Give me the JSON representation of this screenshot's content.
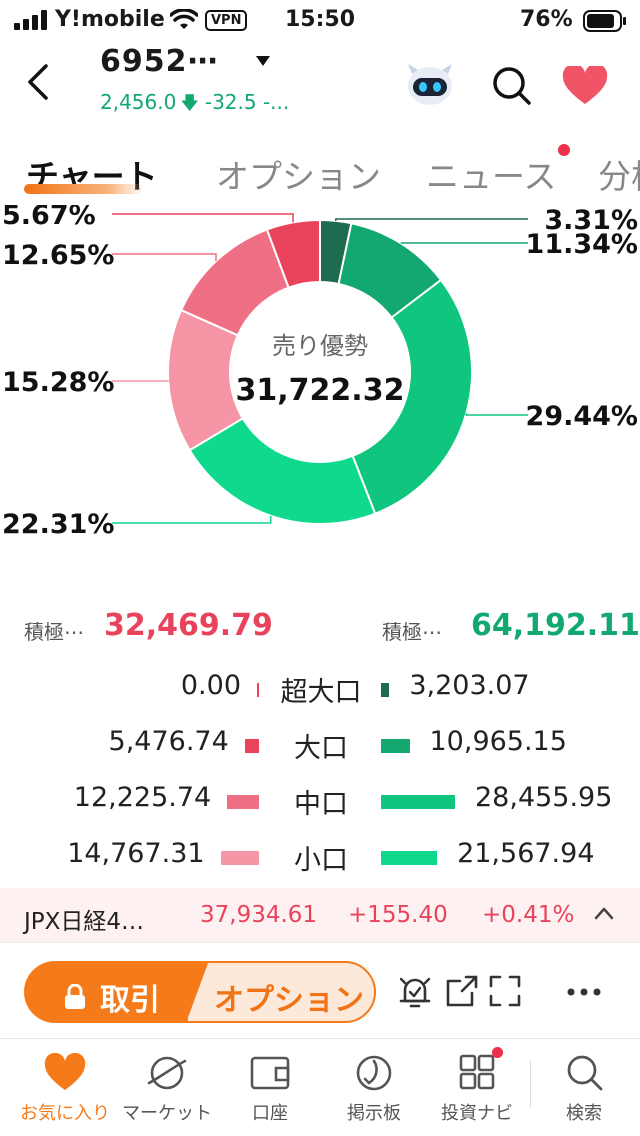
{
  "status_bar": {
    "carrier": "Y!mobile",
    "vpn": "VPN",
    "time": "15:50",
    "battery": "76%"
  },
  "header": {
    "stock_code": "6952⋯",
    "price": "2,456.0",
    "change": "-32.5",
    "change_pct": "-...",
    "quote_color": "#12a870"
  },
  "tabs": [
    {
      "label": "チャート",
      "active": true
    },
    {
      "label": "オプション",
      "active": false
    },
    {
      "label": "ニュース",
      "active": false
    },
    {
      "label": "分析",
      "active": false
    }
  ],
  "donut": {
    "center_label": "売り優勢",
    "center_value": "31,722.32",
    "segments": [
      {
        "pct": 3.31,
        "label": "3.31%",
        "color": "#1f6b4f"
      },
      {
        "pct": 11.34,
        "label": "11.34%",
        "color": "#12a870"
      },
      {
        "pct": 29.44,
        "label": "29.44%",
        "color": "#10c67e"
      },
      {
        "pct": 22.31,
        "label": "22.31%",
        "color": "#0fd98c"
      },
      {
        "pct": 15.28,
        "label": "15.28%",
        "color": "#f595a6"
      },
      {
        "pct": 12.65,
        "label": "12.65%",
        "color": "#ef6f84"
      },
      {
        "pct": 5.67,
        "label": "5.67%",
        "color": "#e9435c"
      }
    ]
  },
  "summary": {
    "sell_label": "積極⋯",
    "sell_value": "32,469.79",
    "buy_label": "積極⋯",
    "buy_value": "64,192.11"
  },
  "breakdown": [
    {
      "label": "超大口",
      "sell": "0.00",
      "sell_num": 0.0,
      "buy": "3,203.07",
      "buy_num": 3203.07,
      "sell_color": "#e9435c",
      "buy_color": "#1f6b4f"
    },
    {
      "label": "大口",
      "sell": "5,476.74",
      "sell_num": 5476.74,
      "buy": "10,965.15",
      "buy_num": 10965.15,
      "sell_color": "#e9435c",
      "buy_color": "#12a870"
    },
    {
      "label": "中口",
      "sell": "12,225.74",
      "sell_num": 12225.74,
      "buy": "28,455.95",
      "buy_num": 28455.95,
      "sell_color": "#ef6f84",
      "buy_color": "#10c67e"
    },
    {
      "label": "小口",
      "sell": "14,767.31",
      "sell_num": 14767.31,
      "buy": "21,567.94",
      "buy_num": 21567.94,
      "sell_color": "#f595a6",
      "buy_color": "#0fd98c"
    }
  ],
  "index_bar": {
    "name": "JPX日経4…",
    "price": "37,934.61",
    "change": "+155.40",
    "pct": "+0.41%"
  },
  "actions": {
    "trade_label": "取引",
    "option_label": "オプション"
  },
  "bottom_nav": [
    {
      "label": "お気に入り",
      "icon": "heart-icon",
      "active": true
    },
    {
      "label": "マーケット",
      "icon": "planet-icon",
      "active": false
    },
    {
      "label": "口座",
      "icon": "wallet-icon",
      "active": false
    },
    {
      "label": "掲示板",
      "icon": "board-icon",
      "active": false
    },
    {
      "label": "投資ナビ",
      "icon": "grid-icon",
      "active": false
    },
    {
      "label": "検索",
      "icon": "search-icon",
      "active": false
    }
  ]
}
